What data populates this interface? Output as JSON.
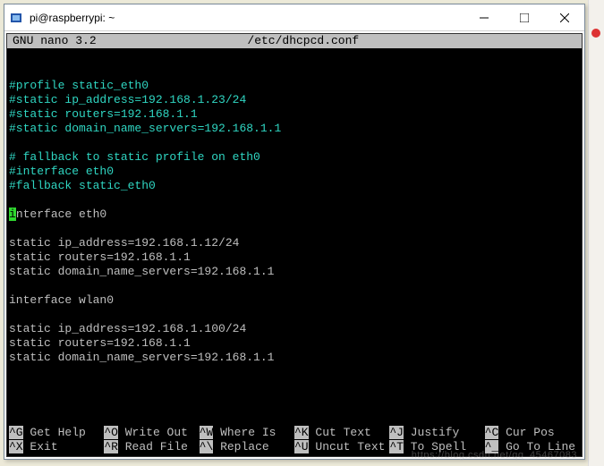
{
  "window": {
    "title": "pi@raspberrypi: ~"
  },
  "nano": {
    "app_label": "GNU nano 3.2",
    "file_path": "/etc/dhcpcd.conf"
  },
  "content": {
    "l1": "#profile static_eth0",
    "l2": "#static ip_address=192.168.1.23/24",
    "l3": "#static routers=192.168.1.1",
    "l4": "#static domain_name_servers=192.168.1.1",
    "l5": "# fallback to static profile on eth0",
    "l6": "#interface eth0",
    "l7": "#fallback static_eth0",
    "cursor_char": "i",
    "l8_rest": "nterface eth0",
    "l9": "static ip_address=192.168.1.12/24",
    "l10": "static routers=192.168.1.1",
    "l11": "static domain_name_servers=192.168.1.1",
    "l12": "interface wlan0",
    "l13": "static ip_address=192.168.1.100/24",
    "l14": "static routers=192.168.1.1",
    "l15": "static domain_name_servers=192.168.1.1"
  },
  "footer": {
    "k1": "^G",
    "t1": " Get Help",
    "k2": "^O",
    "t2": " Write Out",
    "k3": "^W",
    "t3": " Where Is",
    "k4": "^K",
    "t4": " Cut Text",
    "k5": "^J",
    "t5": " Justify",
    "k6": "^C",
    "t6": " Cur Pos",
    "k7": "^X",
    "t7": " Exit",
    "k8": "^R",
    "t8": " Read File",
    "k9": "^\\",
    "t9": " Replace",
    "k10": "^U",
    "t10": " Uncut Text",
    "k11": "^T",
    "t11": " To Spell",
    "k12": "^_",
    "t12": " Go To Line"
  },
  "watermark": "https://blog.csdn.net/qq_45467083"
}
